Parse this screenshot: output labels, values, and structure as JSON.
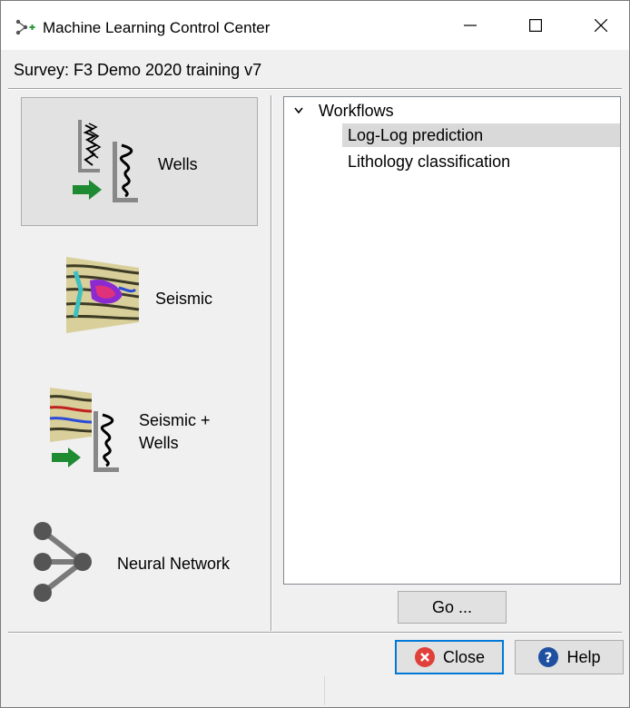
{
  "window": {
    "title": "Machine Learning Control Center",
    "min_symbol": "—",
    "max_symbol": "☐",
    "close_symbol": "✕"
  },
  "survey": {
    "label": "Survey: F3 Demo 2020 training v7"
  },
  "categories": [
    {
      "label": "Wells",
      "icon": "wells-icon",
      "selected": true
    },
    {
      "label": "Seismic",
      "icon": "seismic-icon",
      "selected": false
    },
    {
      "label_line1": "Seismic +",
      "label_line2": "Wells",
      "icon": "seismic-wells-icon",
      "selected": false
    },
    {
      "label": "Neural Network",
      "icon": "neural-network-icon",
      "selected": false
    }
  ],
  "tree": {
    "root": "Workflows",
    "items": [
      {
        "label": "Log-Log prediction",
        "selected": true
      },
      {
        "label": "Lithology classification",
        "selected": false
      }
    ]
  },
  "buttons": {
    "go": "Go ...",
    "close": "Close",
    "help": "Help"
  },
  "colors": {
    "accent": "#0078d7",
    "close_icon": "#e0403a",
    "help_icon": "#1f4fa0",
    "arrow_green": "#1e8a32"
  }
}
